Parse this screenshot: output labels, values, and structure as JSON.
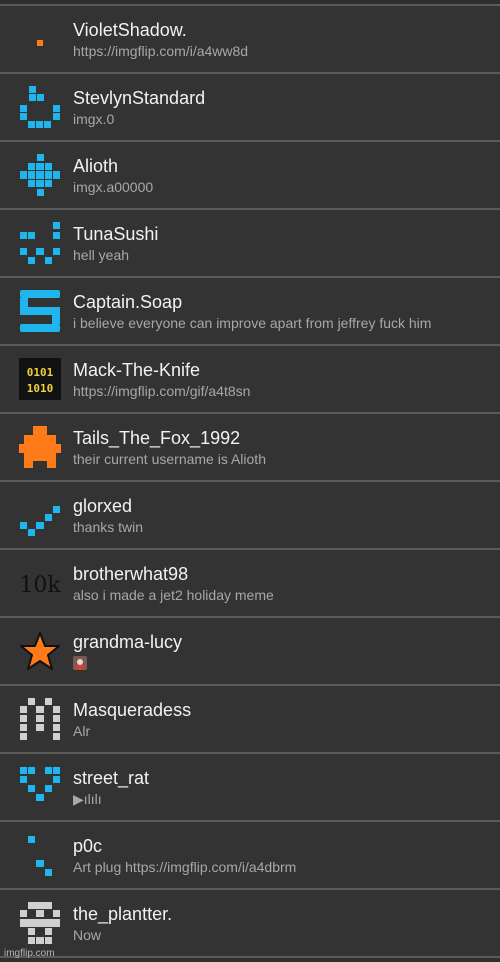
{
  "colors": {
    "background": "#333333",
    "divider": "#5a5a5a",
    "username": "#f2f2f2",
    "message": "#a8a8a8",
    "blue": "#1fb5ee",
    "orange": "#ff7b1a",
    "gray_avatar": "#cfcfcf"
  },
  "rows": [
    {
      "username": "VioletShadow.",
      "message": "https://imgflip.com/i/a4ww8d",
      "avatar_icon": "orange-dot-icon"
    },
    {
      "username": "StevlynStandard",
      "message": "imgx.0",
      "avatar_icon": "blue-smile-icon"
    },
    {
      "username": "Alioth",
      "message": "imgx.a00000",
      "avatar_icon": "blue-diamond-icon"
    },
    {
      "username": "TunaSushi",
      "message": "hell yeah",
      "avatar_icon": "blue-face-icon"
    },
    {
      "username": "Captain.Soap",
      "message": "i believe everyone can improve apart from jeffrey fuck him",
      "avatar_icon": "blue-s-icon"
    },
    {
      "username": "Mack-The-Knife",
      "message": "https://imgflip.com/gif/a4t8sn",
      "avatar_icon": "binary-icon"
    },
    {
      "username": "Tails_The_Fox_1992",
      "message": "their current username is Alioth",
      "avatar_icon": "orange-blob-icon"
    },
    {
      "username": "glorxed",
      "message": "thanks twin",
      "avatar_icon": "blue-check-icon"
    },
    {
      "username": "brotherwhat98",
      "message": "also i made a jet2 holiday meme",
      "avatar_icon": "text-10k-icon",
      "avatar_text": "10k"
    },
    {
      "username": "grandma-lucy",
      "message": "",
      "avatar_icon": "orange-star-icon",
      "message_icon": "image-emoji-icon"
    },
    {
      "username": "Masqueradess",
      "message": "Alr",
      "avatar_icon": "gray-m-icon"
    },
    {
      "username": "street_rat",
      "message": "▶ılılı",
      "avatar_icon": "blue-heart-icon"
    },
    {
      "username": "p0c",
      "message": "Art plug https://imgflip.com/i/a4dbrm",
      "avatar_icon": "blue-dots-icon"
    },
    {
      "username": "the_plantter.",
      "message": "Now",
      "avatar_icon": "gray-skull-icon"
    }
  ],
  "watermark": "imgflip.com"
}
